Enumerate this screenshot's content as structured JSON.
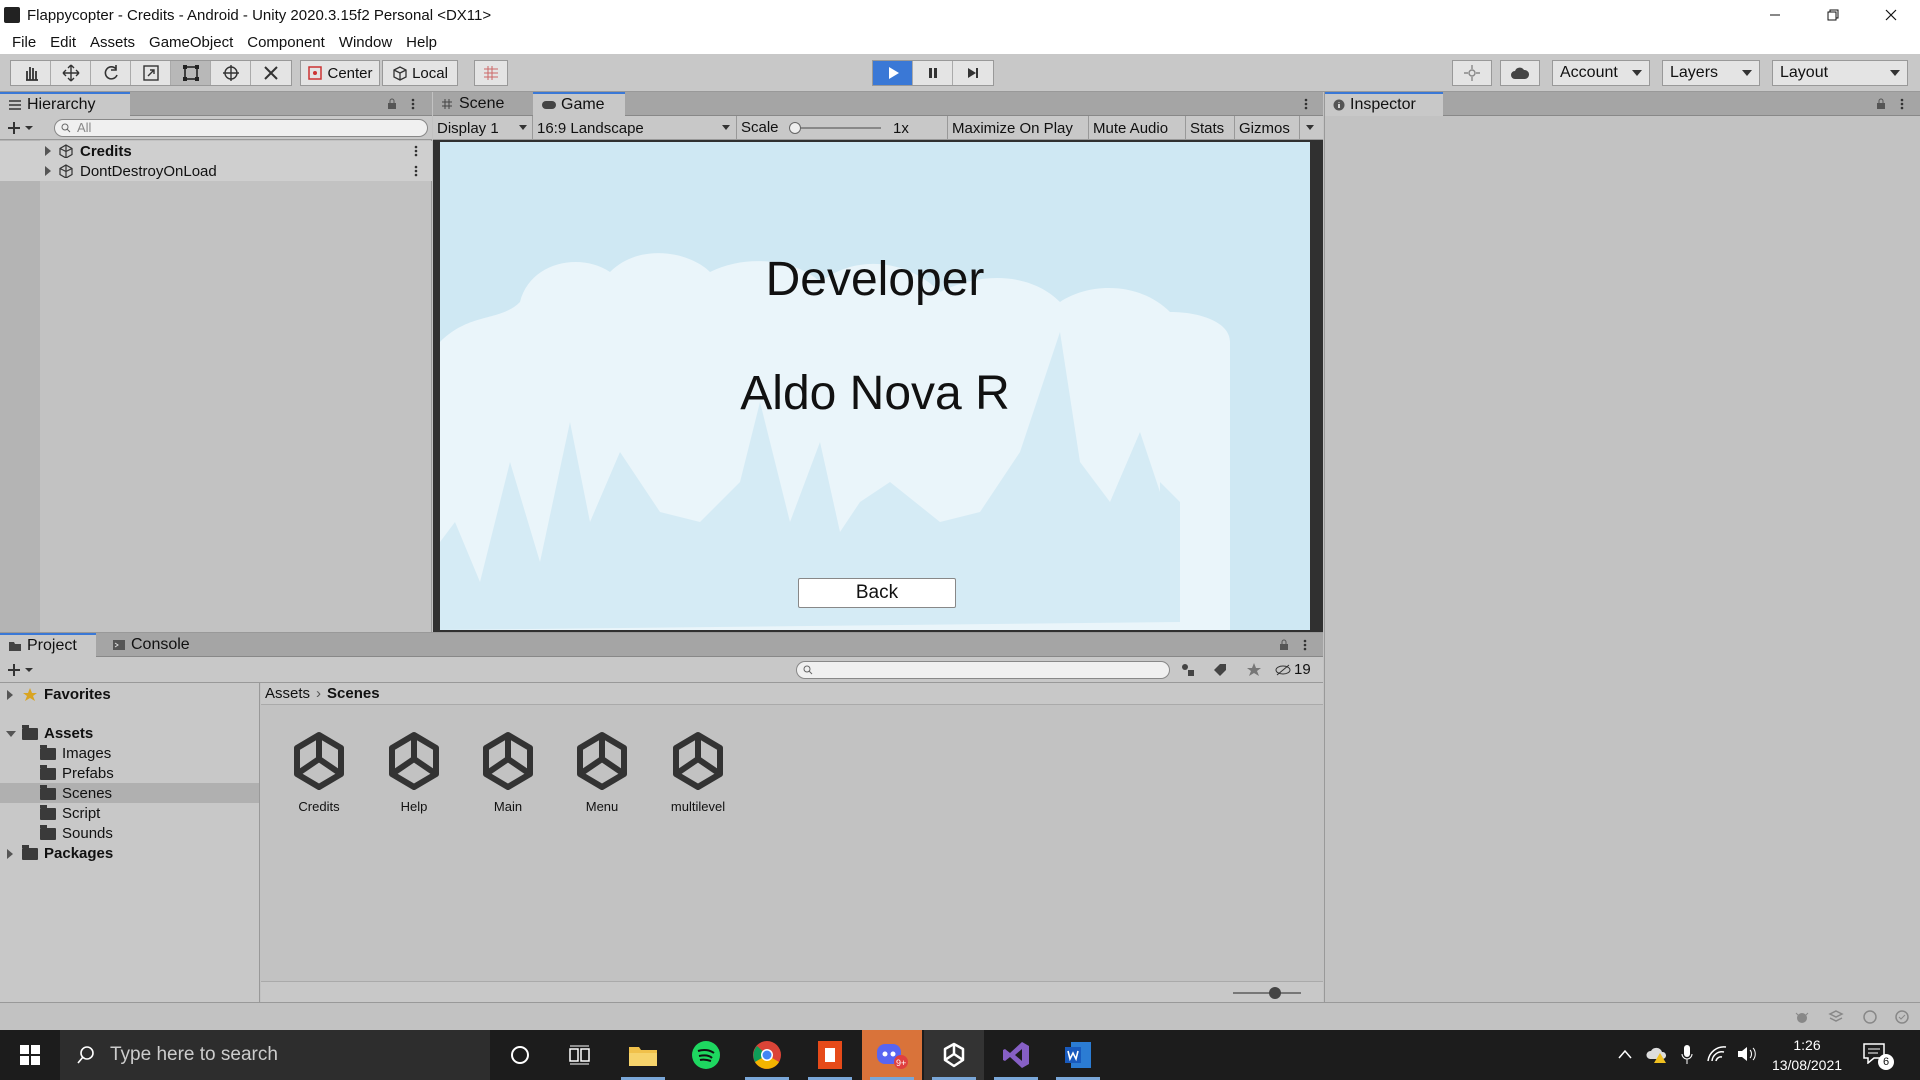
{
  "window": {
    "title": "Flappycopter - Credits - Android - Unity 2020.3.15f2 Personal <DX11>"
  },
  "menu": [
    "File",
    "Edit",
    "Assets",
    "GameObject",
    "Component",
    "Window",
    "Help"
  ],
  "toolbar": {
    "pivot_label": "Center",
    "space_label": "Local",
    "account_label": "Account",
    "layers_label": "Layers",
    "layout_label": "Layout",
    "play_color": "#3a78d6"
  },
  "hierarchy": {
    "tab": "Hierarchy",
    "search_placeholder": "All",
    "items": [
      "Credits",
      "DontDestroyOnLoad"
    ]
  },
  "scene_tabs": {
    "scene": "Scene",
    "game": "Game"
  },
  "game_toolbar": {
    "display": "Display 1",
    "aspect": "16:9 Landscape",
    "scale_label": "Scale",
    "scale_value": "1x",
    "maximize": "Maximize On Play",
    "mute": "Mute Audio",
    "stats": "Stats",
    "gizmos": "Gizmos"
  },
  "game": {
    "heading": "Developer",
    "name": "Aldo Nova R",
    "back_button": "Back",
    "sky_color": "#cfe8f3",
    "cloud_color": "#eaf5fa"
  },
  "inspector": {
    "tab": "Inspector"
  },
  "project": {
    "tab_project": "Project",
    "tab_console": "Console",
    "hidden_count": "19",
    "favorites": "Favorites",
    "assets": "Assets",
    "folders": [
      "Images",
      "Prefabs",
      "Scenes",
      "Script",
      "Sounds"
    ],
    "packages": "Packages",
    "breadcrumb": [
      "Assets",
      "Scenes"
    ],
    "scene_assets": [
      "Credits",
      "Help",
      "Main",
      "Menu",
      "multilevel"
    ]
  },
  "taskbar": {
    "search_placeholder": "Type here to search",
    "time": "1:26",
    "date": "13/08/2021",
    "notification_count": "6"
  }
}
